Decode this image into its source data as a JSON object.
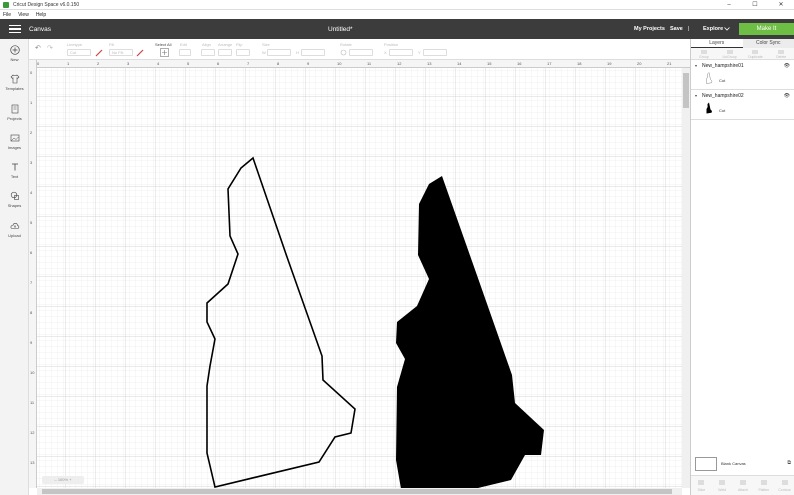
{
  "window": {
    "title": "Cricut Design Space  v6.0.150",
    "minimize": "–",
    "maximize": "☐",
    "close": "✕"
  },
  "menu": [
    "File",
    "View",
    "Help"
  ],
  "header": {
    "section": "Canvas",
    "doc_title": "Untitled*",
    "my_projects": "My Projects",
    "save": "Save",
    "separator": "|",
    "explore": "Explore",
    "make_it": "Make It",
    "accent_color": "#6ebd44"
  },
  "toolbar": {
    "undo": "↶",
    "redo": "↷",
    "linetype_label": "Linetype",
    "linetype_value": "Cut",
    "fill_label": "Fill",
    "fill_value": "No Fill",
    "select_all": "Select All",
    "edit": "Edit",
    "align": "Align",
    "arrange": "Arrange",
    "flip": "Flip",
    "size": "Size",
    "w": "W",
    "h": "H",
    "rotate": "Rotate",
    "position": "Position",
    "x": "X",
    "y": "Y"
  },
  "leftbar": [
    {
      "label": "New",
      "icon": "plus-icon"
    },
    {
      "label": "Templates",
      "icon": "shirt-icon"
    },
    {
      "label": "Projects",
      "icon": "projects-icon"
    },
    {
      "label": "Images",
      "icon": "images-icon"
    },
    {
      "label": "Text",
      "icon": "text-icon"
    },
    {
      "label": "Shapes",
      "icon": "shapes-icon"
    },
    {
      "label": "Upload",
      "icon": "upload-icon"
    }
  ],
  "ruler": {
    "top": [
      "0",
      "1",
      "2",
      "3",
      "4",
      "5",
      "6",
      "7",
      "8",
      "9",
      "10",
      "11",
      "12",
      "13",
      "14",
      "15",
      "16",
      "17",
      "18",
      "19",
      "20",
      "21"
    ],
    "left": [
      "0",
      "1",
      "2",
      "3",
      "4",
      "5",
      "6",
      "7",
      "8",
      "9",
      "10",
      "11",
      "12",
      "13"
    ]
  },
  "zoom": "– 100% +",
  "panel": {
    "tabs": [
      "Layers",
      "Color Sync"
    ],
    "layer_actions": [
      "Group",
      "UnGroup",
      "Duplicate",
      "Delete"
    ],
    "layers": [
      {
        "name": "New_hampshire01",
        "sub": "Cut"
      },
      {
        "name": "New_hampshire02",
        "sub": "Cut"
      }
    ],
    "blank_canvas": "Blank Canvas",
    "bottom_actions": [
      "Slice",
      "Weld",
      "Attach",
      "Flatten",
      "Contour"
    ]
  }
}
